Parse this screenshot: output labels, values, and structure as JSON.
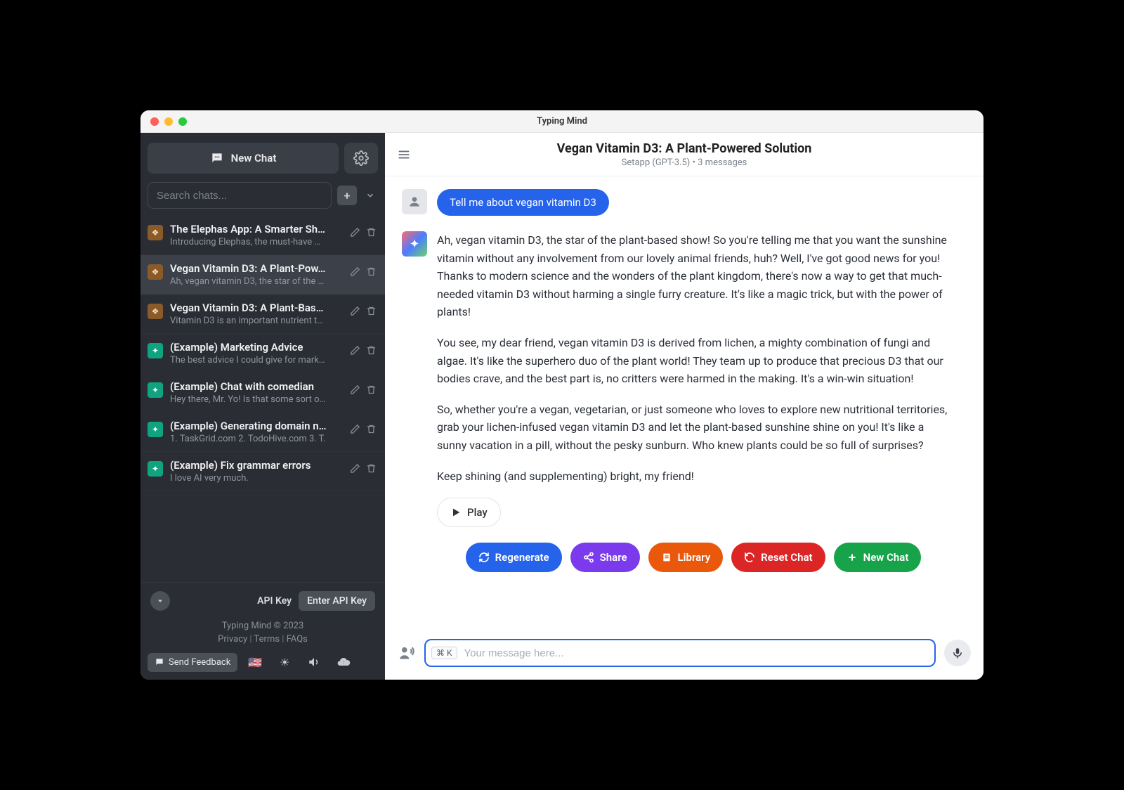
{
  "window": {
    "title": "Typing Mind"
  },
  "sidebar": {
    "newChat": "New Chat",
    "searchPlaceholder": "Search chats...",
    "chats": [
      {
        "title": "The Elephas App: A Smarter Sh…",
        "preview": "Introducing Elephas, the must-have …",
        "avatar": "diamond"
      },
      {
        "title": "Vegan Vitamin D3: A Plant-Pow…",
        "preview": "Ah, vegan vitamin D3, the star of the …",
        "avatar": "diamond",
        "active": true
      },
      {
        "title": "Vegan Vitamin D3: A Plant-Bas…",
        "preview": "Vitamin D3 is an important nutrient t…",
        "avatar": "diamond"
      },
      {
        "title": "(Example) Marketing Advice",
        "preview": "The best advice I could give for mark…",
        "avatar": "green"
      },
      {
        "title": "(Example) Chat with comedian",
        "preview": "Hey there, Mr. Yo! Is that some sort o…",
        "avatar": "green"
      },
      {
        "title": "(Example) Generating domain n…",
        "preview": "1. TaskGrid.com 2. TodoHive.com 3. T.",
        "avatar": "green"
      },
      {
        "title": "(Example) Fix grammar errors",
        "preview": "I love AI very much.",
        "avatar": "green"
      }
    ],
    "apiLabel": "API Key",
    "apiButton": "Enter API Key",
    "copyright": "Typing Mind © 2023",
    "privacy": "Privacy",
    "terms": "Terms",
    "faqs": "FAQs",
    "feedback": "Send Feedback"
  },
  "main": {
    "title": "Vegan Vitamin D3: A Plant-Powered Solution",
    "subtitle": "Setapp (GPT-3.5)  •  3 messages",
    "userMessage": "Tell me about vegan vitamin D3",
    "aiParagraphs": [
      "Ah, vegan vitamin D3, the star of the plant-based show! So you're telling me that you want the sunshine vitamin without any involvement from our lovely animal friends, huh? Well, I've got good news for you! Thanks to modern science and the wonders of the plant kingdom, there's now a way to get that much-needed vitamin D3 without harming a single furry creature. It's like a magic trick, but with the power of plants!",
      "You see, my dear friend, vegan vitamin D3 is derived from lichen, a mighty combination of fungi and algae. It's like the superhero duo of the plant world! They team up to produce that precious D3 that our bodies crave, and the best part is, no critters were harmed in the making. It's a win-win situation!",
      "So, whether you're a vegan, vegetarian, or just someone who loves to explore new nutritional territories, grab your lichen-infused vegan vitamin D3 and let the plant-based sunshine shine on you! It's like a sunny vacation in a pill, without the pesky sunburn. Who knew plants could be so full of surprises?",
      "Keep shining (and supplementing) bright, my friend!"
    ],
    "play": "Play",
    "actions": {
      "regenerate": "Regenerate",
      "share": "Share",
      "library": "Library",
      "reset": "Reset Chat",
      "newChat": "New Chat"
    },
    "inputHint": "⌘ K",
    "inputPlaceholder": "Your message here..."
  }
}
